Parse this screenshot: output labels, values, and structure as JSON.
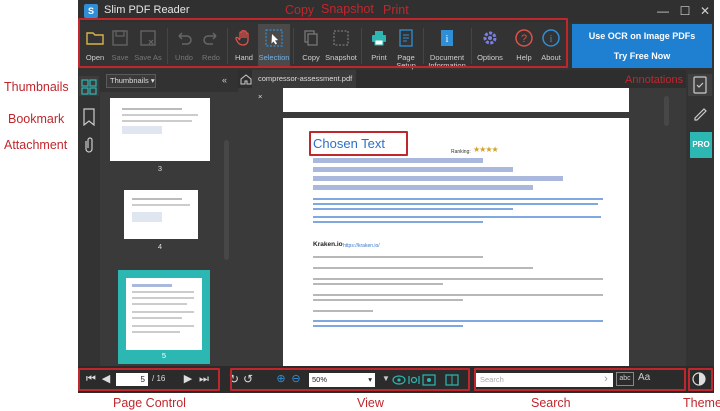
{
  "app": {
    "title": "Slim PDF Reader"
  },
  "toolbar": {
    "open": "Open",
    "save": "Save",
    "save_as": "Save As",
    "undo": "Undo",
    "redo": "Redo",
    "hand": "Hand",
    "selection": "Selection",
    "copy": "Copy",
    "snapshot": "Snapshot",
    "print": "Print",
    "page_setup": "Page\nSetup",
    "doc_info": "Document\nInformation",
    "options": "Options",
    "help": "Help",
    "about": "About"
  },
  "ocr": {
    "line1": "Use OCR on Image PDFs",
    "line2": "Try Free Now"
  },
  "thumbs": {
    "dropdown": "Thumbnails",
    "pages": [
      "3",
      "4",
      "5"
    ]
  },
  "tab": {
    "label": "compressor-assessment.pdf",
    "close": "×"
  },
  "doc": {
    "heading": "Chosen Text",
    "ranking": "Ranking:",
    "stars": "★★★★",
    "kraken": "Kraken.io",
    "kraken_link": "https://kraken.io/"
  },
  "rightrail": {
    "pro": "PRO"
  },
  "status": {
    "page_value": "5",
    "page_total": "/ 16",
    "zoom": "50%",
    "search_placeholder": "Search"
  },
  "annotations": {
    "copy": "Copy",
    "snapshot": "Snapshot",
    "print": "Print",
    "thumbnails": "Thumbnails",
    "bookmark": "Bookmark",
    "attachment": "Attachment",
    "annotations": "Annotations",
    "page_control": "Page Control",
    "view": "View",
    "search": "Search",
    "theme": "Theme"
  },
  "colors": {
    "accent": "#1f7fd0",
    "pro": "#2db7b2",
    "annotation": "#c0272d",
    "selection_blue": "#2f8fd6"
  }
}
